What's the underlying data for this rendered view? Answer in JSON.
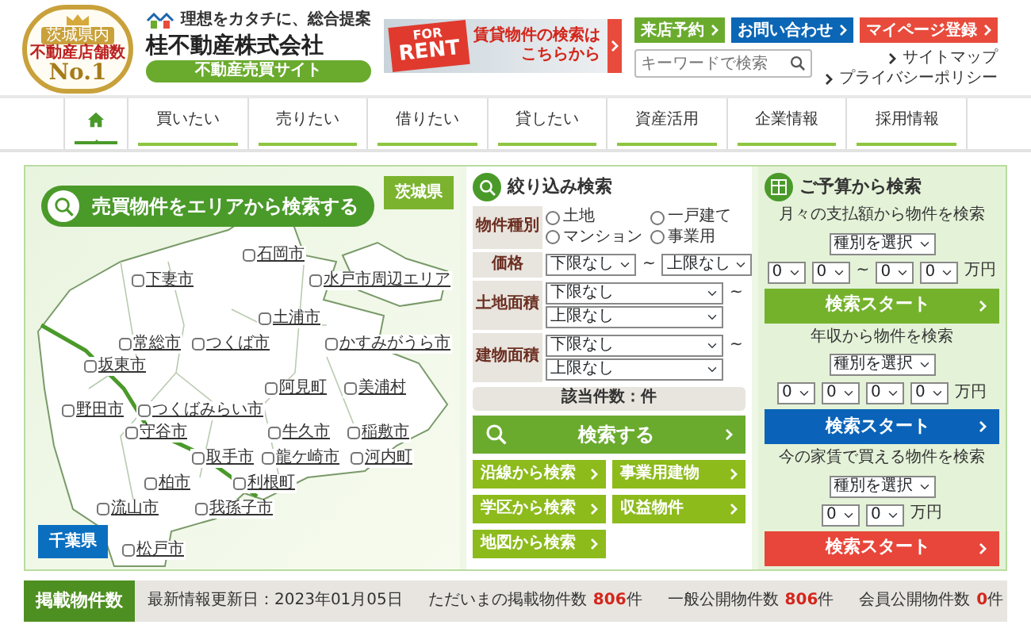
{
  "header": {
    "award": {
      "ribbon": "茨城県内",
      "caption": "不動産店舗数",
      "rank": "No.1"
    },
    "logo": {
      "tagline": "理想をカタチに、総合提案",
      "company": "桂不動産株式会社",
      "subtitle": "不動産売買サイト"
    },
    "banner": {
      "sign_top": "FOR",
      "sign_main": "RENT",
      "text_lines": [
        "賃貸物件の検索は",
        "こちらから"
      ]
    },
    "buttons": [
      {
        "label": "来店予約",
        "color": "#6aab2e"
      },
      {
        "label": "お問い合わせ",
        "color": "#0b66b5"
      },
      {
        "label": "マイページ登録",
        "color": "#e84b3c"
      }
    ],
    "search": {
      "placeholder": "キーワードで検索"
    },
    "links": [
      "サイトマップ",
      "プライバシーポリシー"
    ]
  },
  "nav": {
    "items": [
      {
        "kind": "home",
        "selected": true
      },
      {
        "kind": "text",
        "label": "買いたい",
        "selected": false
      },
      {
        "kind": "text",
        "label": "売りたい",
        "selected": false
      },
      {
        "kind": "text",
        "label": "借りたい",
        "selected": false
      },
      {
        "kind": "text",
        "label": "貸したい",
        "selected": false
      },
      {
        "kind": "text",
        "label": "資産活用",
        "selected": false
      },
      {
        "kind": "text",
        "label": "企業情報",
        "selected": false
      },
      {
        "kind": "text",
        "label": "採用情報",
        "selected": false
      }
    ]
  },
  "area_search": {
    "title": "売買物件をエリアから検索する",
    "prefectures": [
      {
        "label": "茨城県",
        "color": "#7bb32e"
      },
      {
        "label": "千葉県",
        "color": "#0b6fc0"
      }
    ],
    "areas": [
      {
        "label": "石岡市",
        "checked": false
      },
      {
        "label": "下妻市",
        "checked": false
      },
      {
        "label": "水戸市周辺エリア",
        "checked": false
      },
      {
        "label": "土浦市",
        "checked": false
      },
      {
        "label": "常総市",
        "checked": false
      },
      {
        "label": "つくば市",
        "checked": false
      },
      {
        "label": "かすみがうら市",
        "checked": false
      },
      {
        "label": "坂東市",
        "checked": false
      },
      {
        "label": "阿見町",
        "checked": false
      },
      {
        "label": "美浦村",
        "checked": false
      },
      {
        "label": "野田市",
        "checked": false
      },
      {
        "label": "つくばみらい市",
        "checked": false
      },
      {
        "label": "守谷市",
        "checked": false
      },
      {
        "label": "牛久市",
        "checked": false
      },
      {
        "label": "稲敷市",
        "checked": false
      },
      {
        "label": "取手市",
        "checked": false
      },
      {
        "label": "龍ケ崎市",
        "checked": false
      },
      {
        "label": "河内町",
        "checked": false
      },
      {
        "label": "柏市",
        "checked": false
      },
      {
        "label": "利根町",
        "checked": false
      },
      {
        "label": "流山市",
        "checked": false
      },
      {
        "label": "我孫子市",
        "checked": false
      },
      {
        "label": "松戸市",
        "checked": false
      }
    ]
  },
  "filter": {
    "title": "絞り込み検索",
    "rows": [
      {
        "kind": "radios",
        "label": "物件種別",
        "options": [
          {
            "label": "土地",
            "selected": false
          },
          {
            "label": "一戸建て",
            "selected": false
          },
          {
            "label": "マンション",
            "selected": false
          },
          {
            "label": "事業用",
            "selected": false
          }
        ]
      },
      {
        "kind": "inline",
        "label": "価格",
        "from": "下限なし",
        "separator": "~",
        "to": "上限なし"
      },
      {
        "kind": "stacked",
        "label": "土地面積",
        "from": "下限なし",
        "separator": "~",
        "to": "上限なし"
      },
      {
        "kind": "stacked",
        "label": "建物面積",
        "from": "下限なし",
        "separator": "~",
        "to": "上限なし"
      }
    ],
    "result": "該当件数：件",
    "search_button": "検索する",
    "links": [
      "沿線から検索",
      "事業用建物",
      "学区から検索",
      "収益物件",
      "地図から検索"
    ]
  },
  "budget": {
    "title": "ご予算から検索",
    "sections": [
      {
        "label": "月々の支払額から物件を検索",
        "type_select": "種別を選択",
        "groups": [
          [
            "0",
            "0"
          ],
          [
            "0",
            "0"
          ]
        ],
        "separator": "~",
        "unit": "万円",
        "button": {
          "label": "検索スタート",
          "color": "#74b22c"
        }
      },
      {
        "label": "年収から物件を検索",
        "type_select": "種別を選択",
        "groups": [
          [
            "0",
            "0",
            "0",
            "0"
          ]
        ],
        "unit": "万円",
        "button": {
          "label": "検索スタート",
          "color": "#0a63b8"
        }
      },
      {
        "label": "今の家賃で買える物件を検索",
        "type_select": "種別を選択",
        "groups": [
          [
            "0",
            "0"
          ]
        ],
        "unit": "万円",
        "button": {
          "label": "検索スタート",
          "color": "#e8463a"
        }
      }
    ]
  },
  "stats": {
    "title": "掲載物件数",
    "updated": "最新情報更新日：2023年01月05日",
    "counts": [
      {
        "label": "ただいまの掲載物件数",
        "value": "806",
        "unit": "件"
      },
      {
        "label": "一般公開物件数",
        "value": "806",
        "unit": "件"
      },
      {
        "label": "会員公開物件数",
        "value": "0",
        "unit": "件"
      }
    ]
  }
}
